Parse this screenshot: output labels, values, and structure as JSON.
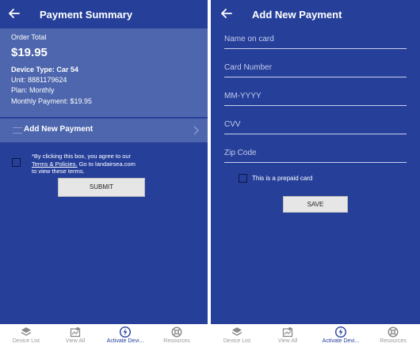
{
  "left_screen": {
    "header": {
      "title": "Payment Summary",
      "back_icon": "arrow-left-icon"
    },
    "summary": {
      "order_total_label": "Order Total",
      "order_total_amount": "$19.95",
      "device_type": "Device Type:  Car 54",
      "unit": "Unit:  8881179624",
      "plan": "Plan:  Monthly",
      "monthly_payment": "Monthly Payment:  $19.95"
    },
    "add_payment": {
      "label": "Add New Payment",
      "chevron_icon": "chevron-right-icon"
    },
    "terms": {
      "line1": "*By clicking this box, you agree to our",
      "link": "Terms & Policies.",
      "line2_suffix": " Go to landairsea.com",
      "line3": "to view these terms."
    },
    "submit_label": "SUBMIT"
  },
  "right_screen": {
    "header": {
      "title": "Add New Payment",
      "back_icon": "arrow-left-icon"
    },
    "fields": {
      "name": "Name on card",
      "card_number": "Card Number",
      "expiry": "MM-YYYY",
      "cvv": "CVV",
      "zip": "Zip Code"
    },
    "prepaid_label": "This is a prepaid card",
    "save_label": "SAVE"
  },
  "nav": {
    "items": [
      {
        "label": "Device List",
        "icon": "layers-icon"
      },
      {
        "label": "View All",
        "icon": "map-icon"
      },
      {
        "label": "Activate Devi...",
        "icon": "bolt-icon"
      },
      {
        "label": "Resources",
        "icon": "lifebuoy-icon"
      }
    ]
  },
  "colors": {
    "primary": "#26409a",
    "panel": "#4d66ad",
    "button": "#e6e6e6",
    "nav_active": "#26409a",
    "nav_inactive": "#9a9a9a"
  }
}
